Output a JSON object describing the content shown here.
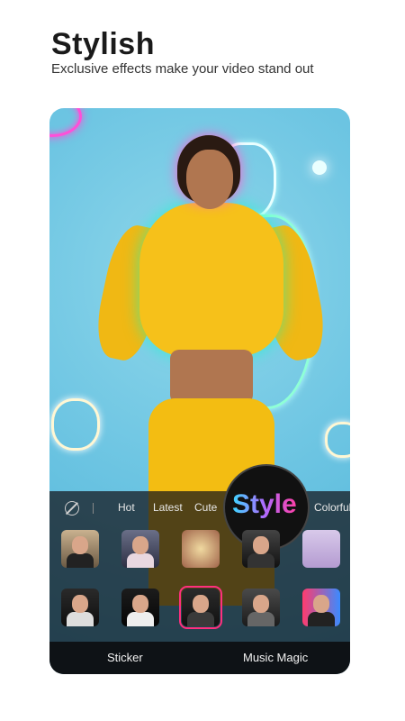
{
  "header": {
    "title": "Stylish",
    "subtitle": "Exclusive effects make your video stand out"
  },
  "effects_panel": {
    "tabs": [
      {
        "label": "Hot"
      },
      {
        "label": "Latest"
      },
      {
        "label": "Cute"
      },
      {
        "label": "Colorful"
      }
    ],
    "active_tab_badge": "Style",
    "rows": [
      [
        {
          "name": "effect-thumb-1"
        },
        {
          "name": "effect-thumb-2"
        },
        {
          "name": "effect-thumb-3"
        },
        {
          "name": "effect-thumb-4"
        },
        {
          "name": "effect-thumb-5"
        }
      ],
      [
        {
          "name": "effect-thumb-6"
        },
        {
          "name": "effect-thumb-7"
        },
        {
          "name": "effect-thumb-8",
          "selected": true
        },
        {
          "name": "effect-thumb-9"
        },
        {
          "name": "effect-thumb-10"
        }
      ]
    ],
    "bottom_bar": {
      "sticker_label": "Sticker",
      "music_magic_label": "Music Magic"
    }
  },
  "colors": {
    "accent": "#ff2f7e",
    "background_sky": "#6fc6e3",
    "hoodie": "#f6c11a"
  }
}
